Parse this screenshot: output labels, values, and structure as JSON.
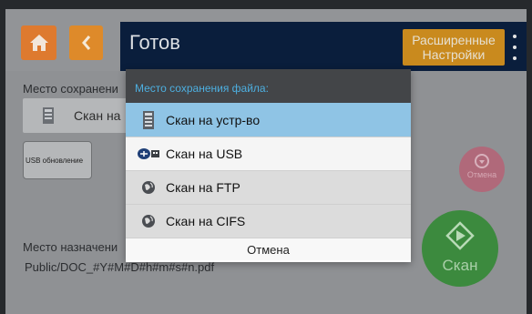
{
  "header": {
    "title": "Готов",
    "advanced_label_line1": "Расширенные",
    "advanced_label_line2": "Настройки"
  },
  "background": {
    "save_location_label": "Место сохранени",
    "save_location_value": "Скан на",
    "usb_update_label": "USB обновление",
    "destination_label": "Место назначени",
    "destination_path": "Public/DOC_#Y#M#D#h#m#s#n.pdf",
    "cancel_label": "Отмена",
    "scan_label": "Скан"
  },
  "dialog": {
    "title": "Место сохранения файла:",
    "options": [
      {
        "label": "Скан на устр-во",
        "icon": "device-icon",
        "selected": true
      },
      {
        "label": "Скан на USB",
        "icon": "usb-icon",
        "selected": false
      },
      {
        "label": "Скан на FTP",
        "icon": "globe-icon",
        "selected": false
      },
      {
        "label": "Скан на CIFS",
        "icon": "globe-icon",
        "selected": false
      }
    ],
    "cancel_label": "Отмена"
  },
  "colors": {
    "accent_orange": "#de7a2f",
    "title_bar": "#0a1e3c",
    "dialog_accent": "#4dafe0",
    "selected_option": "#8fc4e5",
    "scan_button": "#3c8a3e",
    "cancel_button": "#b0697a"
  }
}
